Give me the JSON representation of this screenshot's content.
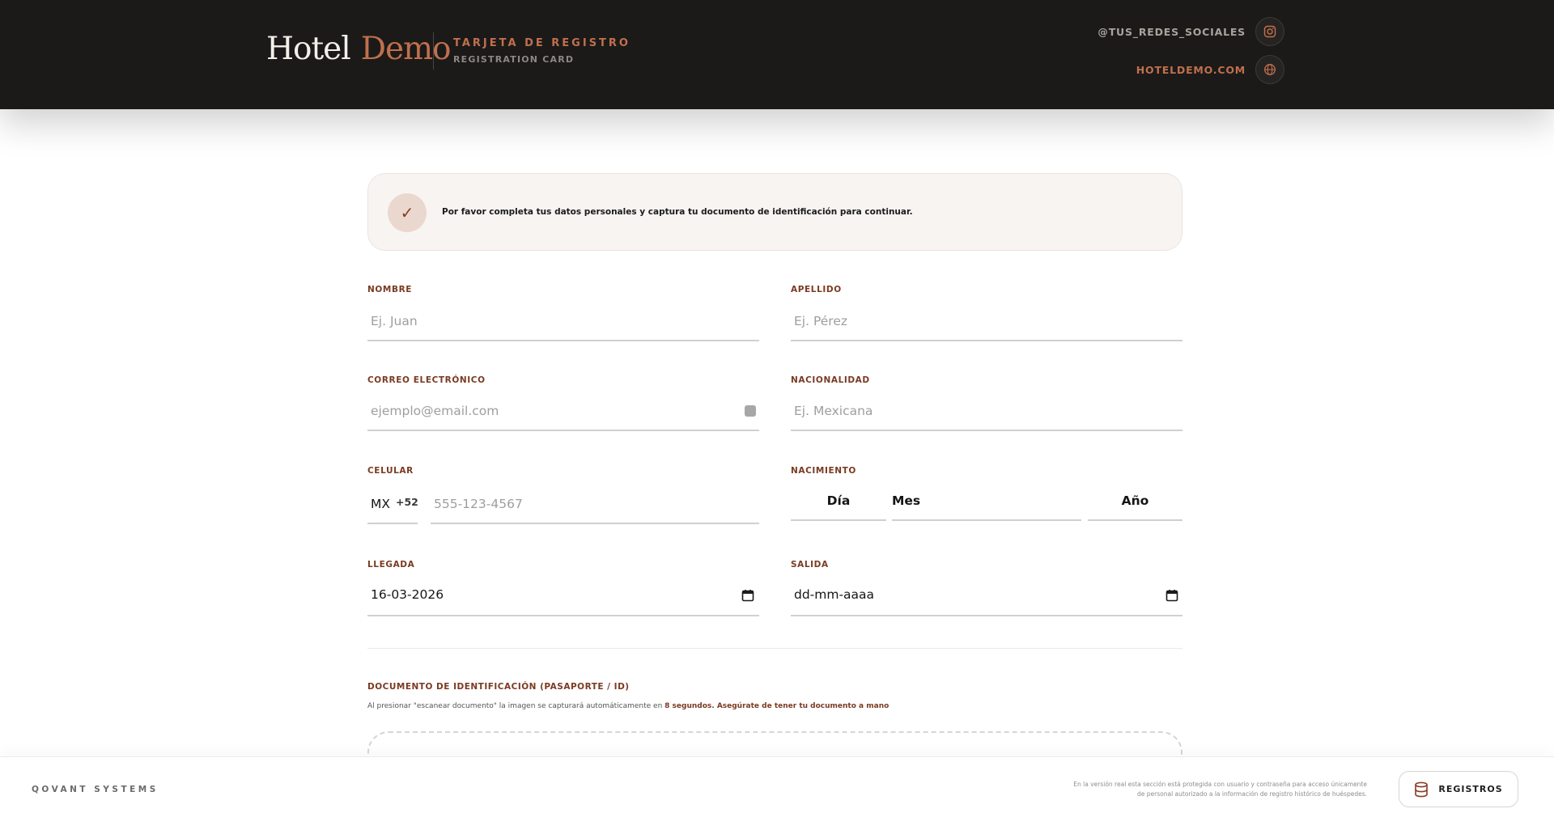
{
  "header": {
    "brand_hotel": "Hotel",
    "brand_demo": "Demo",
    "card_title": "TARJETA DE REGISTRO",
    "card_subtitle": "REGISTRATION CARD",
    "social_handle": "@TUS_REDES_SOCIALES",
    "website": "HOTELDEMO.COM",
    "icons": [
      "instagram-icon",
      "globe-icon"
    ]
  },
  "notice": {
    "icon": "checkmark-icon",
    "check_glyph": "✓",
    "text": "Por favor completa tus datos personales y captura tu documento de identificación para continuar."
  },
  "form": {
    "nombre": {
      "label": "NOMBRE",
      "placeholder": "Ej. Juan",
      "value": ""
    },
    "apellido": {
      "label": "APELLIDO",
      "placeholder": "Ej. Pérez",
      "value": ""
    },
    "correo": {
      "label": "CORREO ELECTRÓNICO",
      "placeholder": "ejemplo@email.com",
      "value": ""
    },
    "nacionalidad": {
      "label": "NACIONALIDAD",
      "placeholder": "Ej. Mexicana",
      "value": ""
    },
    "celular": {
      "label": "CELULAR",
      "country_code": "MX",
      "prefix": "+52",
      "placeholder": "555-123-4567",
      "value": ""
    },
    "nacimiento": {
      "label": "NACIMIENTO",
      "day": "Día",
      "month": "Mes",
      "year": "Año"
    },
    "llegada": {
      "label": "LLEGADA",
      "value": "16-03-2026"
    },
    "salida": {
      "label": "SALIDA",
      "value": "dd-mm-aaaa"
    }
  },
  "document": {
    "title": "DOCUMENTO DE IDENTIFICACIÓN (PASAPORTE / ID)",
    "desc_prefix": "Al presionar \"escanear documento\" la imagen se capturará automáticamente en",
    "desc_seconds": "8 segundos",
    "desc_suffix": ". Asegúrate de tener tu documento a mano"
  },
  "footer": {
    "brand": "QOVANT SYSTEMS",
    "note_line1": "En la versión real esta sección está protegida con usuario y contraseña para acceso únicamente",
    "note_line2": "de personal autorizado a la información de registro histórico de huéspedes.",
    "records_button": "REGISTROS",
    "records_icon": "database-icon"
  },
  "colors": {
    "header_bg": "#1b1a19",
    "accent": "#c0704d",
    "label": "#7a3a22",
    "notice_bg": "#f8f4f2"
  }
}
